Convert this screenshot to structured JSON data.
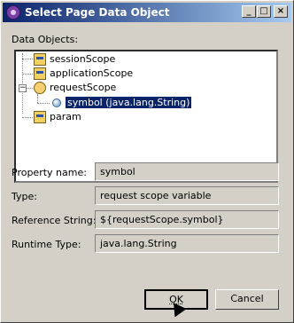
{
  "window": {
    "title": "Select Page Data Object",
    "controls": {
      "minimize": "_",
      "maximize": "□",
      "close": "×"
    }
  },
  "tree": {
    "label": "Data Objects:",
    "nodes": [
      {
        "label": "sessionScope",
        "icon": "scope-icon"
      },
      {
        "label": "applicationScope",
        "icon": "scope-icon"
      },
      {
        "label": "requestScope",
        "icon": "person-icon",
        "expander": "−"
      },
      {
        "label": "symbol (java.lang.String)",
        "icon": "ball-icon",
        "selected": true
      },
      {
        "label": "param",
        "icon": "scope-icon"
      }
    ]
  },
  "properties": {
    "property_name": {
      "label": "Property name:",
      "value": "symbol"
    },
    "type": {
      "label": "Type:",
      "value": "request scope variable"
    },
    "reference_string": {
      "label": "Reference String:",
      "value": "${requestScope.symbol}"
    },
    "runtime_type": {
      "label": "Runtime Type:",
      "value": "java.lang.String"
    }
  },
  "buttons": {
    "ok": "OK",
    "cancel": "Cancel"
  }
}
